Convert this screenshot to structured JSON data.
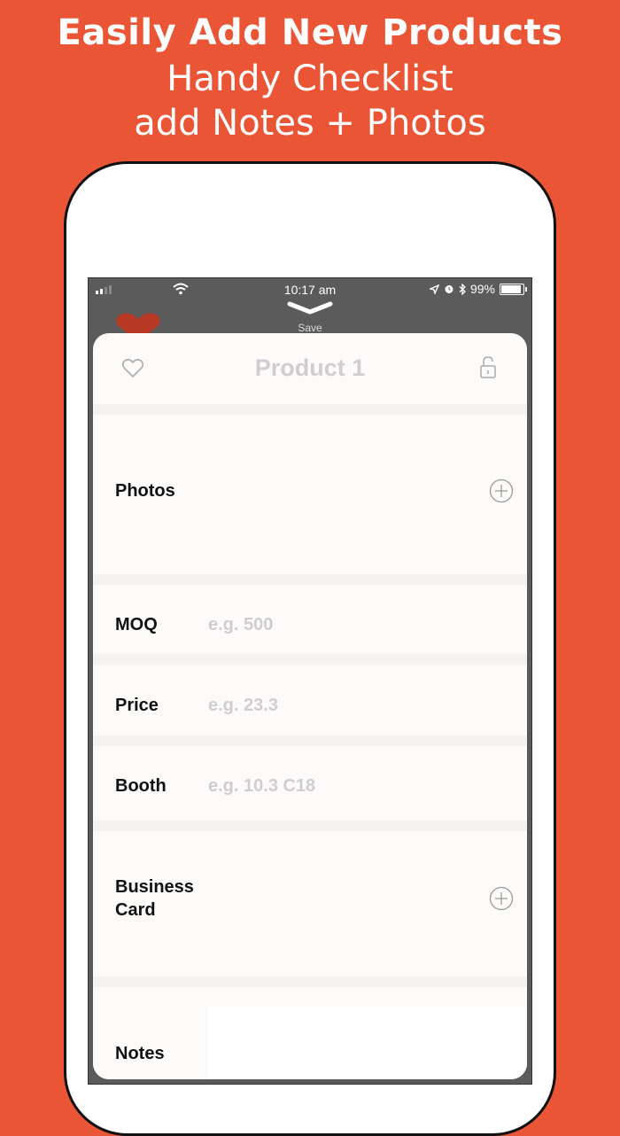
{
  "banner": {
    "line1": "Easily Add New Products",
    "line2": "Handy Checklist",
    "line3": "add Notes + Photos"
  },
  "statusbar": {
    "time": "10:17 am",
    "battery": "99%"
  },
  "handle": {
    "save_label": "Save"
  },
  "sheet": {
    "title": "Product 1",
    "favorite_icon": "heart-outline-icon",
    "lock_icon": "unlock-icon",
    "photos_label": "Photos",
    "moq_label": "MOQ",
    "moq_placeholder": "e.g. 500",
    "price_label": "Price",
    "price_placeholder": "e.g. 23.3",
    "booth_label": "Booth",
    "booth_placeholder": "e.g. 10.3 C18",
    "business_card_label_1": "Business",
    "business_card_label_2": "Card",
    "notes_label": "Notes"
  },
  "colors": {
    "background": "#e95535",
    "placeholder": "#cfcdd1",
    "sheet": "#fcfbfa"
  }
}
